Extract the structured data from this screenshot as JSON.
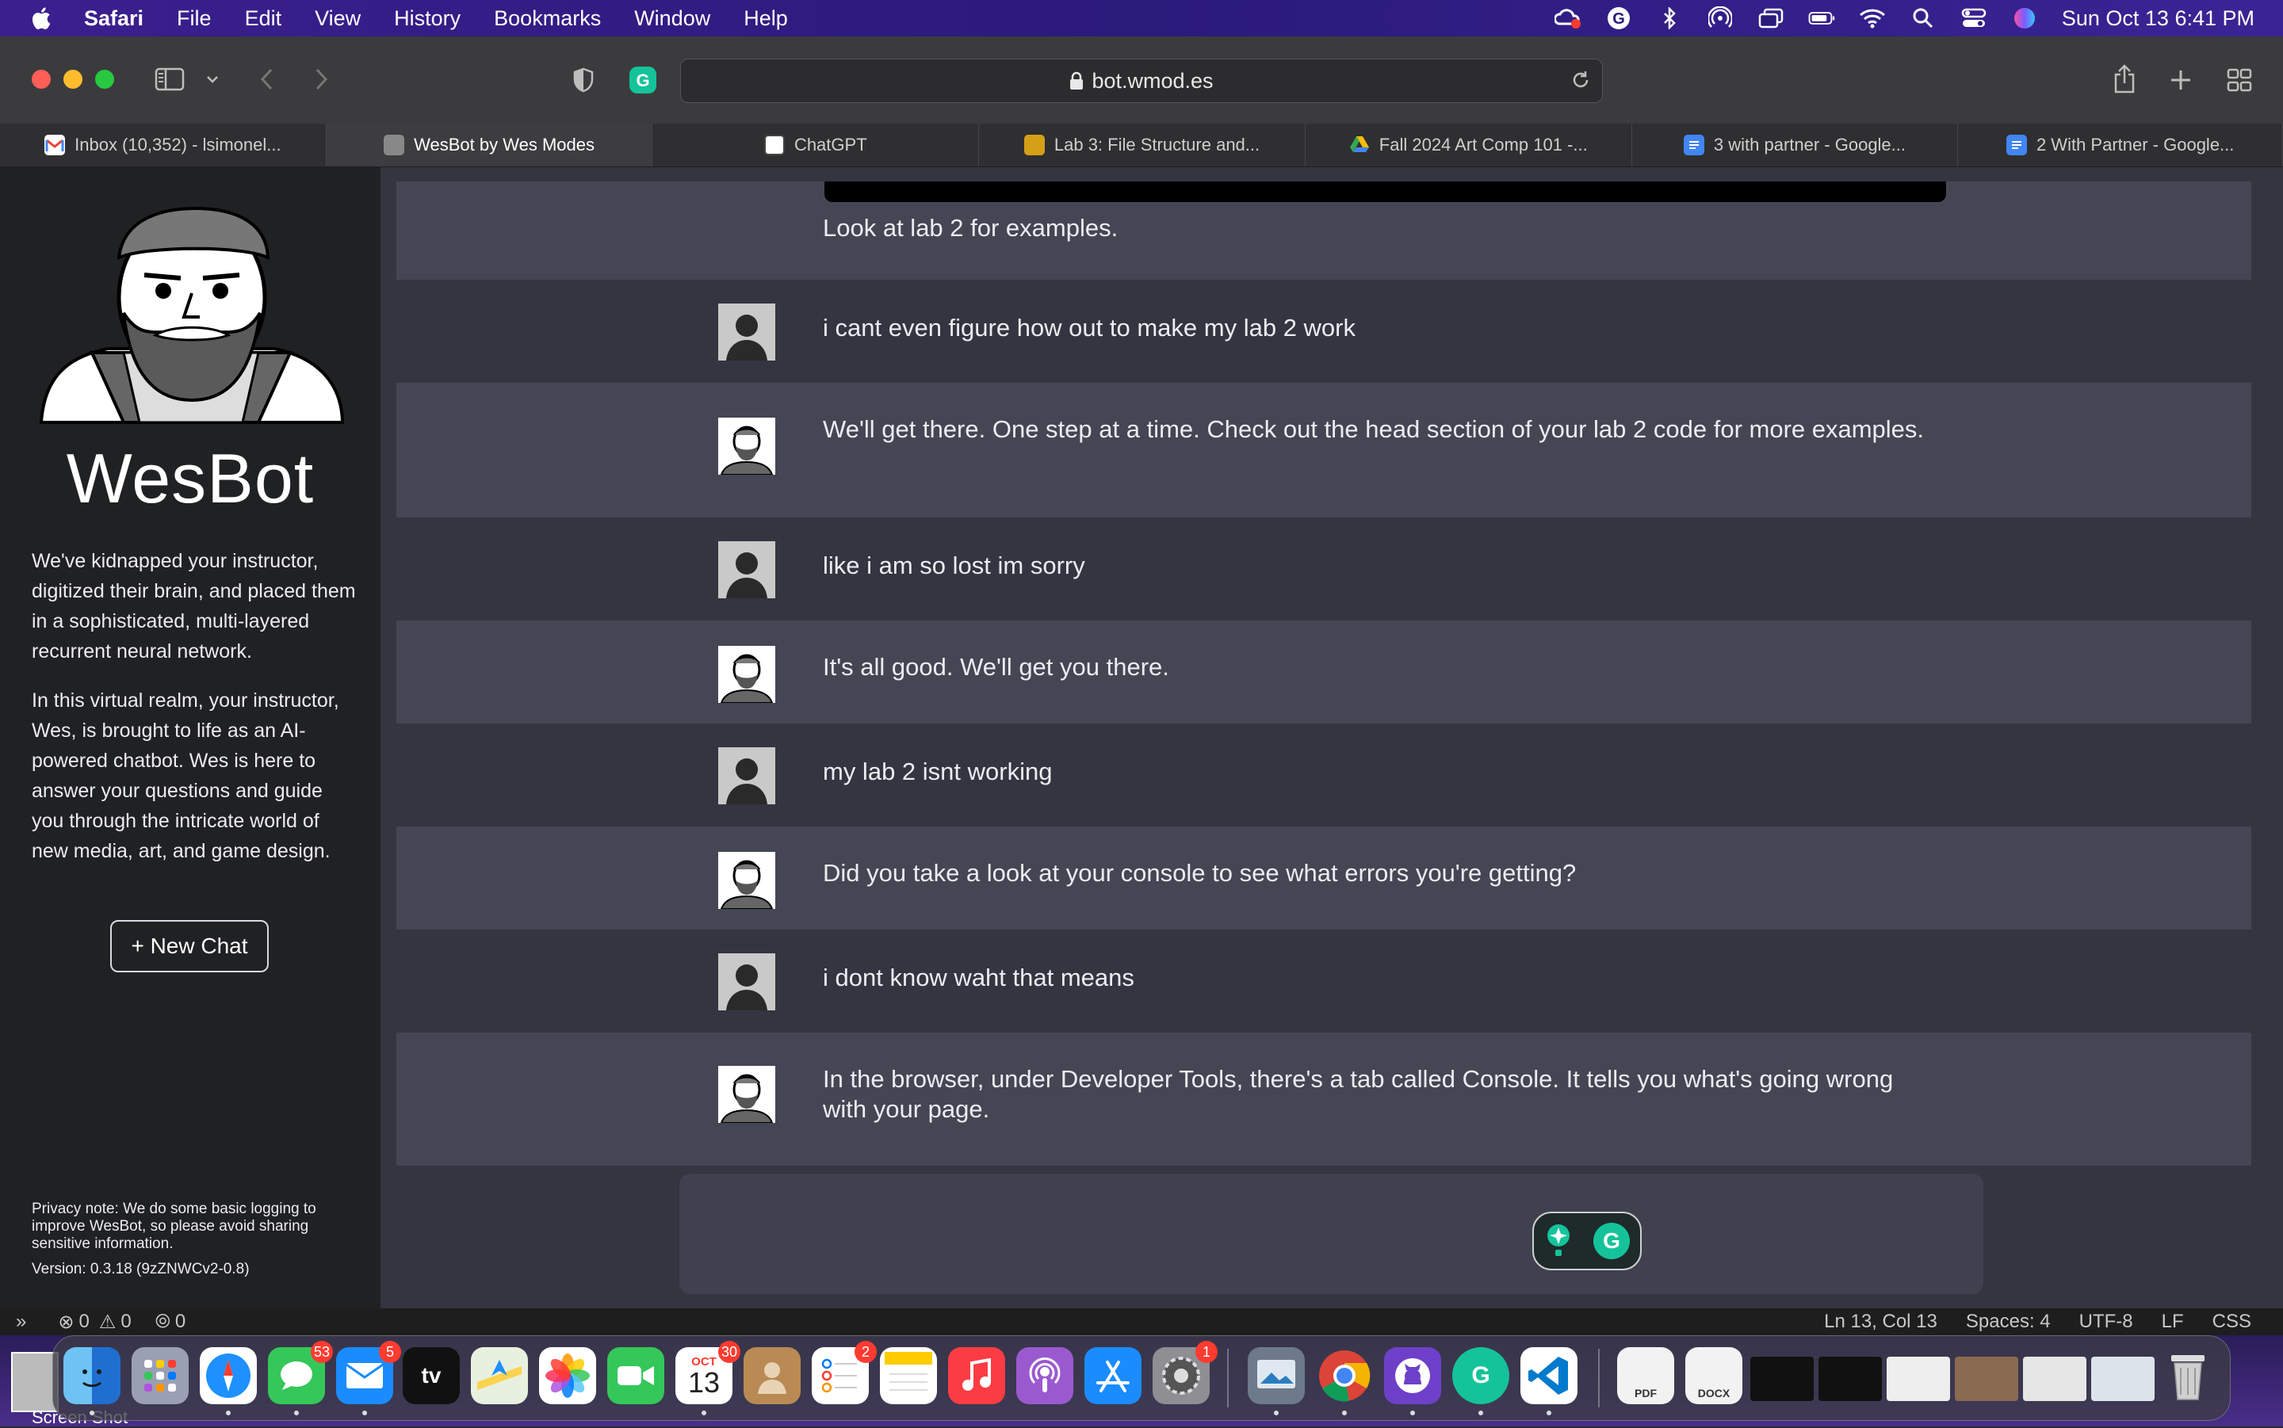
{
  "menubar": {
    "app": "Safari",
    "items": [
      "File",
      "Edit",
      "View",
      "History",
      "Bookmarks",
      "Window",
      "Help"
    ],
    "clock": "Sun Oct 13  6:41 PM"
  },
  "browser": {
    "url": "bot.wmod.es",
    "tabs": [
      {
        "label": "Inbox (10,352) - lsimonel...",
        "icon": "gmail-icon",
        "color": "#ea4335"
      },
      {
        "label": "WesBot by Wes Modes",
        "icon": "wesbot-icon",
        "color": "#777777",
        "active": true
      },
      {
        "label": "ChatGPT",
        "icon": "chatgpt-icon",
        "color": "#222222"
      },
      {
        "label": "Lab 3: File Structure and...",
        "icon": "ucsc-icon",
        "color": "#d4a017"
      },
      {
        "label": "Fall 2024 Art Comp 101 -...",
        "icon": "drive-icon",
        "color": "#34a853"
      },
      {
        "label": "3 with partner - Google...",
        "icon": "docs-icon",
        "color": "#4285f4"
      },
      {
        "label": "2 With Partner - Google...",
        "icon": "docs-icon",
        "color": "#4285f4"
      }
    ]
  },
  "sidebar": {
    "brand": "WesBot",
    "desc1": "We've kidnapped your instructor, digitized their brain, and placed them in a sophisticated, multi-layered recurrent neural network.",
    "desc2": "In this virtual realm, your instructor, Wes, is brought to life as an AI-powered chatbot. Wes is here to answer your questions and guide you through the intricate world of new media, art, and game design.",
    "new_chat": "+ New Chat",
    "privacy": "Privacy note: We do some basic logging to improve WesBot, so please avoid sharing sensitive information.",
    "version": "Version: 0.3.18 (9zZNWCv2-0.8)"
  },
  "chat": {
    "messages": [
      {
        "role": "bot",
        "text": "Look at lab 2 for examples."
      },
      {
        "role": "user",
        "text": "i cant even figure how out to make my lab 2 work"
      },
      {
        "role": "bot",
        "text": "We'll get there. One step at a time. Check out the head section of your lab 2 code for more examples."
      },
      {
        "role": "user",
        "text": "like i am so lost im sorry"
      },
      {
        "role": "bot",
        "text": "It's all good. We'll get you there."
      },
      {
        "role": "user",
        "text": "my lab 2 isnt working"
      },
      {
        "role": "bot",
        "text": "Did you take a look at your console to see what errors you're getting?"
      },
      {
        "role": "user",
        "text": "i dont know waht that means"
      },
      {
        "role": "bot",
        "text": "In the browser, under Developer Tools, there's a tab called Console. It tells you what's going wrong with your page."
      }
    ]
  },
  "statusbar": {
    "errors": "0",
    "warnings": "0",
    "ports": "0",
    "position": "Ln 13, Col 13",
    "spaces": "Spaces: 4",
    "encoding": "UTF-8",
    "eol": "LF",
    "language": "CSS"
  },
  "dock": {
    "messages_badge": "53",
    "mail_badge": "5",
    "calendar_month": "OCT",
    "calendar_day": "13",
    "calendar_badge": "30",
    "reminders_badge": "2",
    "settings_badge": "1",
    "tv_label": "tv",
    "pdf_label": "PDF",
    "docx_label": "DOCX",
    "screenshot_label": "Screen Shot"
  }
}
